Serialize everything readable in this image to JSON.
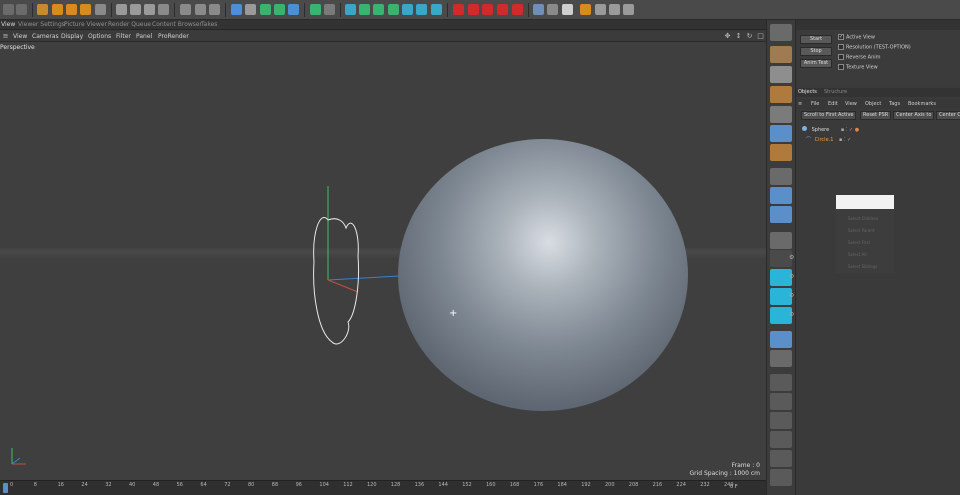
{
  "window_menu": [
    "View",
    "Viewer Settings",
    "Picture Viewer",
    "Render Queue",
    "Content Browser",
    "Takes"
  ],
  "viewport_menu": [
    "View",
    "Cameras",
    "Display",
    "Options",
    "Filter",
    "Panel",
    "ProRender"
  ],
  "viewport": {
    "label": "Perspective",
    "frame": "Frame : 0",
    "grid_spacing": "Grid Spacing : 1000 cm"
  },
  "timeline": {
    "ticks": [
      "0",
      "8",
      "16",
      "24",
      "32",
      "40",
      "48",
      "56",
      "64",
      "72",
      "80",
      "88",
      "96",
      "104",
      "112",
      "120",
      "128",
      "136",
      "144",
      "152",
      "160",
      "168",
      "176",
      "184",
      "192",
      "200",
      "208",
      "216",
      "224",
      "232",
      "240"
    ],
    "frame_counter": "0 F"
  },
  "attributes": {
    "buttons": [
      "Start",
      "Stop",
      "Anim Test"
    ],
    "options": [
      {
        "label": "Active View",
        "checked": true
      },
      {
        "label": "Resolution (TEST-OPTION)",
        "checked": false
      },
      {
        "label": "Reverse Anim",
        "checked": false
      },
      {
        "label": "Texture View",
        "checked": false
      }
    ]
  },
  "objects_panel": {
    "tabs": [
      "Objects",
      "Structure"
    ],
    "menu": [
      "File",
      "Edit",
      "View",
      "Object",
      "Tags",
      "Bookmarks"
    ],
    "buttons": [
      "Scroll to First Active",
      "Reset PSR",
      "Center Axis to",
      "Center O"
    ],
    "objects": [
      {
        "name": "Sphere",
        "color": "#dddddd"
      },
      {
        "name": "Circle.1",
        "color": "#f0a040"
      }
    ],
    "context_menu": [
      "Select Children",
      "Select Parent",
      "Select First",
      "Select All",
      "Select Siblings"
    ]
  }
}
